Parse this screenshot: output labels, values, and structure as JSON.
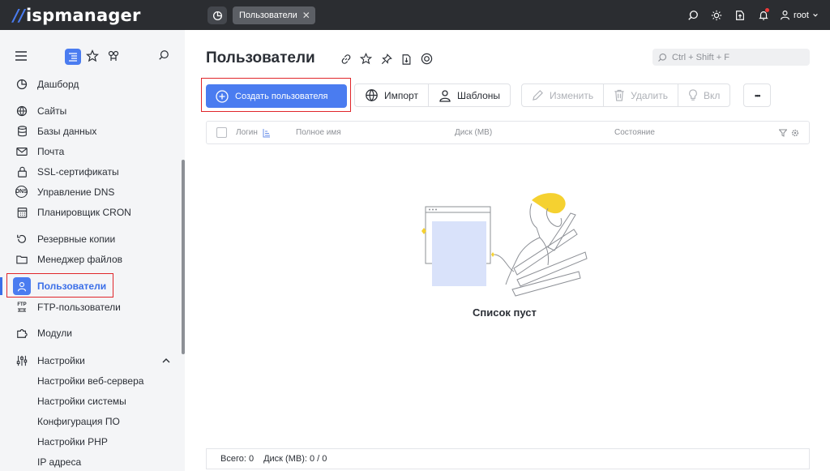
{
  "app": {
    "logo_text": "ispmanager",
    "logo_mark": "//"
  },
  "topbar": {
    "active_tab": "Пользователи",
    "tab_close": "✕",
    "user": "root"
  },
  "sidebar": {
    "items": [
      {
        "label": "Дашборд",
        "icon": "dashboard-icon"
      },
      {
        "label": "Сайты",
        "icon": "globe-icon"
      },
      {
        "label": "Базы данных",
        "icon": "database-icon"
      },
      {
        "label": "Почта",
        "icon": "mail-icon"
      },
      {
        "label": "SSL-сертификаты",
        "icon": "lock-icon"
      },
      {
        "label": "Управление DNS",
        "icon": "dns-icon"
      },
      {
        "label": "Планировщик CRON",
        "icon": "calendar-icon"
      },
      {
        "label": "Резервные копии",
        "icon": "backup-icon"
      },
      {
        "label": "Менеджер файлов",
        "icon": "folder-icon"
      },
      {
        "label": "Пользователи",
        "icon": "user-icon"
      },
      {
        "label": "FTP-пользователи",
        "icon": "ftp-icon"
      },
      {
        "label": "Модули",
        "icon": "puzzle-icon"
      },
      {
        "label": "Настройки",
        "icon": "settings-icon"
      },
      {
        "label": "Настройки веб-сервера"
      },
      {
        "label": "Настройки системы"
      },
      {
        "label": "Конфигурация ПО"
      },
      {
        "label": "Настройки PHP"
      },
      {
        "label": "IP адреса"
      }
    ],
    "dns_badge": "DNS",
    "ftp_badge": "FTP"
  },
  "main": {
    "title": "Пользователи",
    "search_placeholder": "Ctrl + Shift + F",
    "toolbar": {
      "create": "Создать пользователя",
      "import": "Импорт",
      "templates": "Шаблоны",
      "edit": "Изменить",
      "delete": "Удалить",
      "enable": "Вкл",
      "more": "•••"
    },
    "table": {
      "columns": [
        "Логин",
        "Полное имя",
        "Диск (MB)",
        "Состояние"
      ]
    },
    "empty_text": "Список пуст",
    "footer": {
      "total": "Всего: 0",
      "disk": "Диск (MB): 0 / 0"
    }
  },
  "colors": {
    "accent": "#4a7cf0",
    "topbar": "#2b2d31",
    "highlight": "#e0262b",
    "illustration_yellow": "#f5d130"
  }
}
